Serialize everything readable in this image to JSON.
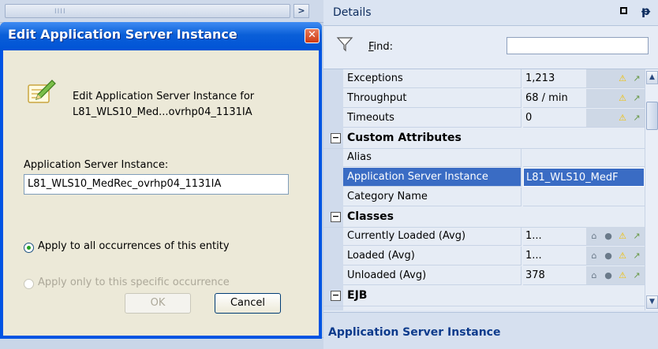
{
  "left_pane": {
    "scroll_grip": "IIII",
    "scroll_arrow": ">"
  },
  "details": {
    "title": "Details",
    "find_label": "Find:",
    "find_value": "",
    "rows": [
      {
        "type": "prop",
        "name": "Exceptions",
        "value": "1,213",
        "icons": [
          "warning-icon",
          "sparkline-icon"
        ]
      },
      {
        "type": "prop",
        "name": "Throughput",
        "value": "68 / min",
        "icons": [
          "warning-icon",
          "sparkline-icon"
        ]
      },
      {
        "type": "prop",
        "name": "Timeouts",
        "value": "0",
        "icons": [
          "warning-icon",
          "sparkline-icon"
        ]
      },
      {
        "type": "category",
        "name": "Custom Attributes"
      },
      {
        "type": "prop",
        "name": "Alias",
        "value": ""
      },
      {
        "type": "prop",
        "name": "Application Server Instance",
        "value": "L81_WLS10_MedF",
        "selected": true
      },
      {
        "type": "prop",
        "name": "Category Name",
        "value": ""
      },
      {
        "type": "category",
        "name": "Classes"
      },
      {
        "type": "prop",
        "name": "Currently Loaded (Avg)",
        "value": "1...",
        "icons": [
          "baseline-icon",
          "search-icon",
          "warning-icon",
          "sparkline-icon"
        ]
      },
      {
        "type": "prop",
        "name": "Loaded (Avg)",
        "value": "1...",
        "icons": [
          "baseline-icon",
          "search-icon",
          "warning-icon",
          "sparkline-icon"
        ]
      },
      {
        "type": "prop",
        "name": "Unloaded (Avg)",
        "value": "378",
        "icons": [
          "baseline-icon",
          "search-icon",
          "warning-icon",
          "sparkline-icon"
        ]
      },
      {
        "type": "category",
        "name": "EJB"
      }
    ],
    "status_text": "Application Server Instance"
  },
  "dialog": {
    "title": "Edit Application Server Instance",
    "close_glyph": "✕",
    "description_line1": "Edit Application Server Instance for",
    "description_line2": "L81_WLS10_Med...ovrhp04_1131IA",
    "field_label": "Application Server Instance:",
    "field_value": "L81_WLS10_MedRec_ovrhp04_1131IA",
    "radio_all": "Apply to all occurrences of this entity",
    "radio_specific": "Apply only to this specific occurrence",
    "ok_label": "OK",
    "cancel_label": "Cancel"
  }
}
